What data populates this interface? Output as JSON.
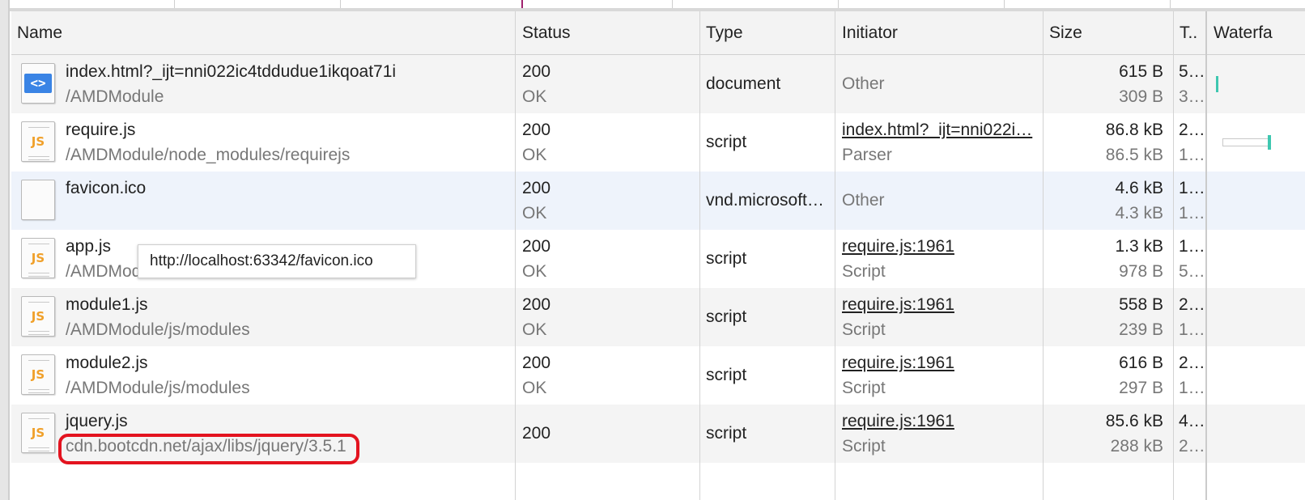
{
  "columns": {
    "name": "Name",
    "status": "Status",
    "type": "Type",
    "initiator": "Initiator",
    "size": "Size",
    "time": "T..",
    "waterfall": "Waterfa"
  },
  "rows": [
    {
      "name": "index.html?_ijt=nni022ic4tddudue1ikqoat71i",
      "path": "/AMDModule",
      "icon": "html-file-icon",
      "status_code": "200",
      "status_text": "OK",
      "type": "document",
      "initiator": "Other",
      "initiator_sub": "",
      "size": "615 B",
      "size_sub": "309 B",
      "time": "5…",
      "time_sub": "3…"
    },
    {
      "name": "require.js",
      "path": "/AMDModule/node_modules/requirejs",
      "icon": "js-file-icon",
      "status_code": "200",
      "status_text": "OK",
      "type": "script",
      "initiator": "index.html?_ijt=nni022i…",
      "initiator_sub": "Parser",
      "size": "86.8 kB",
      "size_sub": "86.5 kB",
      "time": "2…",
      "time_sub": "1…"
    },
    {
      "name": "favicon.ico",
      "path": "",
      "icon": "blank-file-icon",
      "status_code": "200",
      "status_text": "OK",
      "type": "vnd.microsoft…",
      "initiator": "Other",
      "initiator_sub": "",
      "size": "4.6 kB",
      "size_sub": "4.3 kB",
      "time": "1…",
      "time_sub": "1…"
    },
    {
      "name": "app.js",
      "path": "/AMDModu",
      "icon": "js-file-icon",
      "status_code": "200",
      "status_text": "OK",
      "type": "script",
      "initiator": "require.js:1961",
      "initiator_sub": "Script",
      "size": "1.3 kB",
      "size_sub": "978 B",
      "time": "1…",
      "time_sub": "5…"
    },
    {
      "name": "module1.js",
      "path": "/AMDModule/js/modules",
      "icon": "js-file-icon",
      "status_code": "200",
      "status_text": "OK",
      "type": "script",
      "initiator": "require.js:1961",
      "initiator_sub": "Script",
      "size": "558 B",
      "size_sub": "239 B",
      "time": "2…",
      "time_sub": "1…"
    },
    {
      "name": "module2.js",
      "path": "/AMDModule/js/modules",
      "icon": "js-file-icon",
      "status_code": "200",
      "status_text": "OK",
      "type": "script",
      "initiator": "require.js:1961",
      "initiator_sub": "Script",
      "size": "616 B",
      "size_sub": "297 B",
      "time": "2…",
      "time_sub": "1…"
    },
    {
      "name": "jquery.js",
      "path": "cdn.bootcdn.net/ajax/libs/jquery/3.5.1",
      "icon": "js-file-icon",
      "status_code": "200",
      "status_text": "",
      "type": "script",
      "initiator": "require.js:1961",
      "initiator_sub": "Script",
      "size": "85.6 kB",
      "size_sub": "288 kB",
      "time": "4…",
      "time_sub": "2…"
    }
  ],
  "tooltip": {
    "text": "http://localhost:63342/favicon.ico"
  },
  "icon_glyphs": {
    "js": "JS",
    "html": "<>"
  },
  "colors": {
    "highlight": "#e3131f",
    "waterfall_bar": "#3ec7b0",
    "selected_row": "#eef3fb"
  }
}
